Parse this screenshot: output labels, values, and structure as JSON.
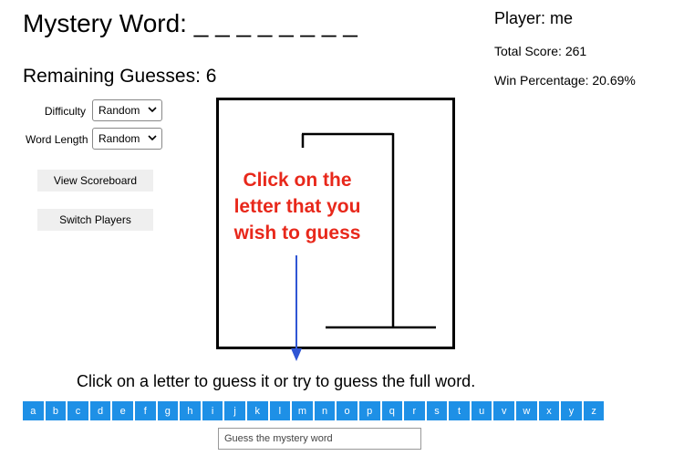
{
  "header": {
    "mystery_label": "Mystery Word:",
    "mystery_blanks": "_ _ _ _ _ _ _ _",
    "remaining_label": "Remaining Guesses:",
    "remaining_count": "6"
  },
  "player": {
    "name_label": "Player: me",
    "total_score_label": "Total Score: 261",
    "win_percentage_label": "Win Percentage: 20.69%"
  },
  "settings": {
    "difficulty_label": "Difficulty",
    "difficulty_value": "Random",
    "word_length_label": "Word Length",
    "word_length_value": "Random"
  },
  "buttons": {
    "view_scoreboard": "View Scoreboard",
    "switch_players": "Switch Players"
  },
  "hint": {
    "line1": "Click on the",
    "line2": "letter that you",
    "line3": "wish to guess",
    "color": "#e8281b"
  },
  "instruction": "Click on a letter to guess it or try to guess the full word.",
  "letters": [
    "a",
    "b",
    "c",
    "d",
    "e",
    "f",
    "g",
    "h",
    "i",
    "j",
    "k",
    "l",
    "m",
    "n",
    "o",
    "p",
    "q",
    "r",
    "s",
    "t",
    "u",
    "v",
    "w",
    "x",
    "y",
    "z"
  ],
  "letter_color": "#1e90e6",
  "guess_input": {
    "placeholder": "Guess the mystery word",
    "value": ""
  }
}
